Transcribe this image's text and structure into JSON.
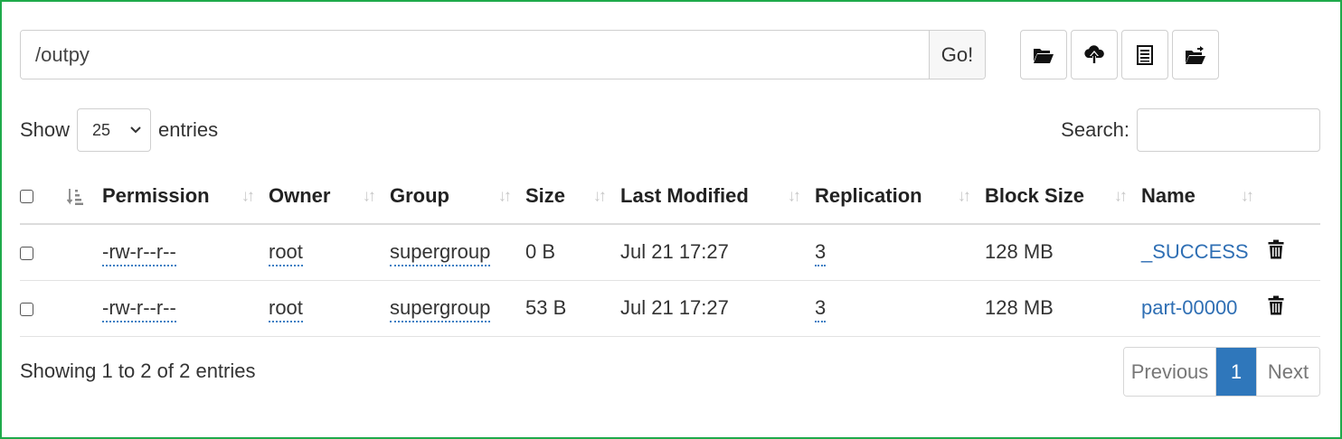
{
  "path_bar": {
    "value": "/outpy",
    "go_label": "Go!"
  },
  "toolbar": {
    "icons": [
      "folder-open-icon",
      "cloud-upload-icon",
      "list-icon",
      "folder-export-icon"
    ]
  },
  "length": {
    "show_label": "Show",
    "selected": "25",
    "entries_label": "entries"
  },
  "search": {
    "label": "Search:"
  },
  "table": {
    "columns": [
      "Permission",
      "Owner",
      "Group",
      "Size",
      "Last Modified",
      "Replication",
      "Block Size",
      "Name"
    ],
    "rows": [
      {
        "permission": "-rw-r--r--",
        "owner": "root",
        "group": "supergroup",
        "size": "0 B",
        "modified": "Jul 21 17:27",
        "replication": "3",
        "block_size": "128 MB",
        "name": "_SUCCESS"
      },
      {
        "permission": "-rw-r--r--",
        "owner": "root",
        "group": "supergroup",
        "size": "53 B",
        "modified": "Jul 21 17:27",
        "replication": "3",
        "block_size": "128 MB",
        "name": "part-00000"
      }
    ]
  },
  "footer": {
    "info": "Showing 1 to 2 of 2 entries",
    "previous": "Previous",
    "current_page": "1",
    "next": "Next"
  },
  "colors": {
    "frame": "#1faa4b",
    "accent": "#2f77bb",
    "link": "#2f6fb4"
  }
}
